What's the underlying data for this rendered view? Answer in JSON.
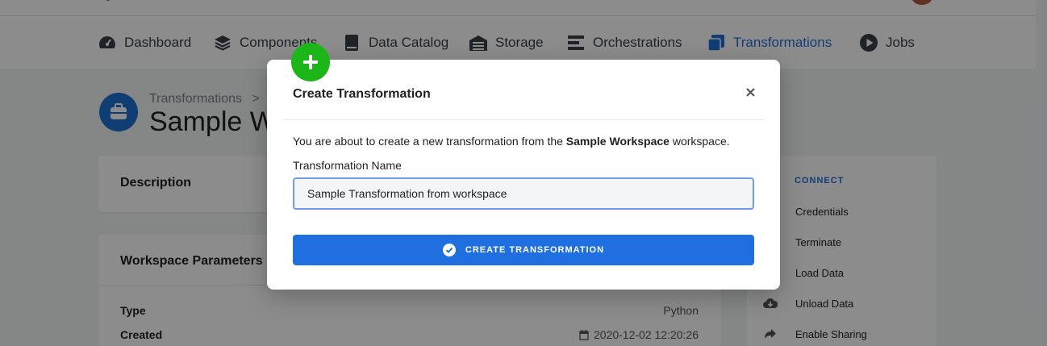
{
  "nav": {
    "items": [
      {
        "label": "Dashboard",
        "icon": "dashboard-icon"
      },
      {
        "label": "Components",
        "icon": "layers-icon"
      },
      {
        "label": "Data Catalog",
        "icon": "book-icon"
      },
      {
        "label": "Storage",
        "icon": "warehouse-icon"
      },
      {
        "label": "Orchestrations",
        "icon": "bars-icon"
      },
      {
        "label": "Transformations",
        "icon": "transform-icon",
        "active": true
      },
      {
        "label": "Jobs",
        "icon": "play-icon"
      }
    ]
  },
  "page": {
    "breadcrumb": "Transformations",
    "breadcrumb_separator": ">",
    "title": "Sample Workspace"
  },
  "description_card": {
    "title": "Description"
  },
  "params_card": {
    "title": "Workspace Parameters",
    "rows": [
      {
        "label": "Type",
        "value": "Python"
      },
      {
        "label": "Created",
        "value": "2020-12-02 12:20:26"
      }
    ]
  },
  "side_panel": {
    "heading": "CONNECT",
    "items": [
      {
        "label": "Credentials",
        "icon": "key-icon"
      },
      {
        "label": "Terminate",
        "icon": "stop-icon"
      },
      {
        "label": "Load Data",
        "icon": "upload-icon"
      },
      {
        "label": "Unload Data",
        "icon": "cloud-download-icon"
      },
      {
        "label": "Enable Sharing",
        "icon": "share-icon"
      }
    ]
  },
  "modal": {
    "title": "Create Transformation",
    "intro_before": "You are about to create a new transformation from the ",
    "intro_strong": "Sample Workspace",
    "intro_after": " workspace.",
    "field_label": "Transformation Name",
    "field_value": "Sample Transformation from workspace",
    "button_label": "CREATE TRANSFORMATION"
  },
  "colors": {
    "accent": "#1f6fd6",
    "button": "#1f6fe0",
    "badge": "#1cb619"
  }
}
